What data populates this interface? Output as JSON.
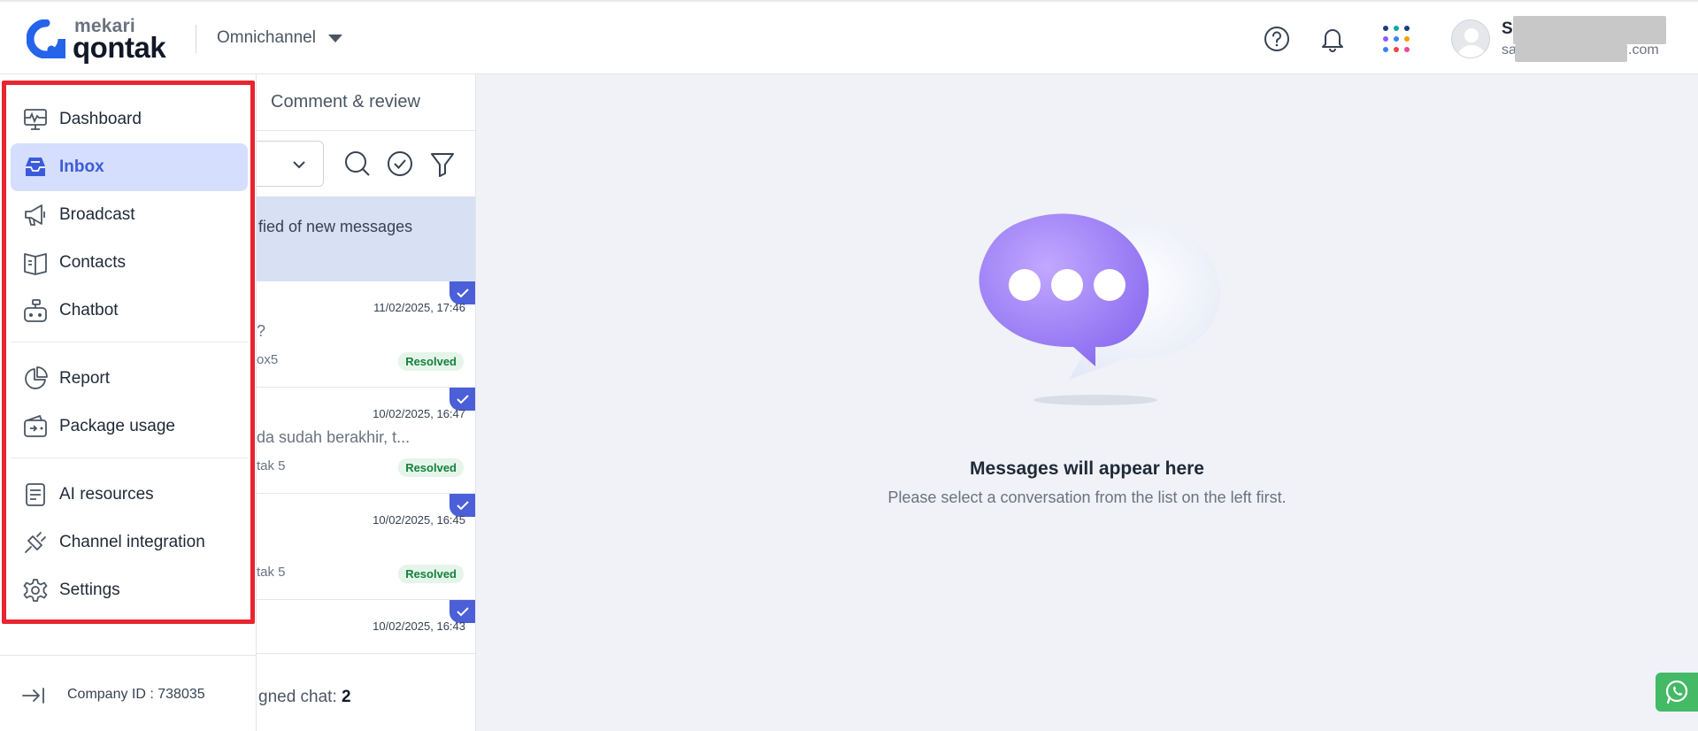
{
  "header": {
    "logo_small": "mekari",
    "logo_big": "qontak",
    "product": "Omnichannel",
    "icons": [
      "help-icon",
      "bell-icon",
      "apps-grid-icon"
    ],
    "user_name_visible": "S",
    "user_email_visible_start": "sa",
    "user_email_visible_end": ".com"
  },
  "sidebar": {
    "groups": [
      [
        {
          "label": "Dashboard",
          "icon": "monitor-pulse-icon",
          "active": false
        },
        {
          "label": "Inbox",
          "icon": "inbox-tray-icon",
          "active": true
        },
        {
          "label": "Broadcast",
          "icon": "megaphone-icon",
          "active": false
        },
        {
          "label": "Contacts",
          "icon": "contact-book-icon",
          "active": false
        },
        {
          "label": "Chatbot",
          "icon": "robot-icon",
          "active": false
        }
      ],
      [
        {
          "label": "Report",
          "icon": "pie-chart-icon",
          "active": false
        },
        {
          "label": "Package usage",
          "icon": "wallet-icon",
          "active": false
        }
      ],
      [
        {
          "label": "AI resources",
          "icon": "document-stack-icon",
          "active": false
        },
        {
          "label": "Channel integration",
          "icon": "plug-icon",
          "active": false
        },
        {
          "label": "Settings",
          "icon": "gear-icon",
          "active": false
        }
      ]
    ],
    "company_id": "Company ID : 738035",
    "highlight_color": "#e8252f"
  },
  "conversations": {
    "tab": "Comment & review",
    "notify_text": "fied of new messages",
    "items": [
      {
        "time": "11/02/2025, 17:46",
        "message": "?",
        "channel": "ox5",
        "status": "Resolved"
      },
      {
        "time": "10/02/2025, 16:47",
        "message": "da sudah berakhir, t...",
        "channel": "tak 5",
        "status": "Resolved"
      },
      {
        "time": "10/02/2025, 16:45",
        "message": "",
        "channel": "tak 5",
        "status": "Resolved"
      },
      {
        "time": "10/02/2025, 16:43",
        "message": "",
        "channel": "",
        "status": ""
      }
    ],
    "assigned_label": "gned chat:",
    "assigned_count": "2"
  },
  "empty_state": {
    "title": "Messages will appear here",
    "subtitle": "Please select a conversation from the list on the left first."
  },
  "colors": {
    "accent": "#3b5bdb",
    "active_bg": "#d5defd",
    "resolved": "#15803d",
    "whatsapp": "#44b966"
  }
}
